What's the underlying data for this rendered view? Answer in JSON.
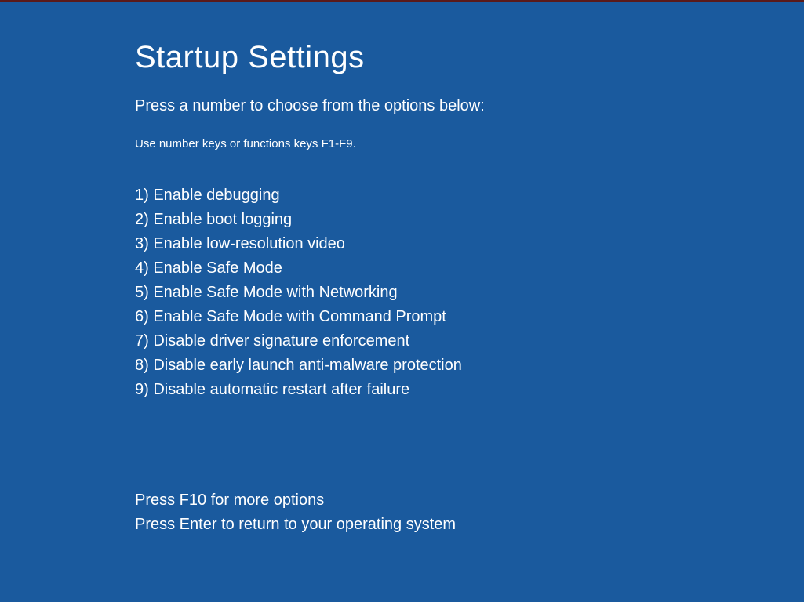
{
  "title": "Startup Settings",
  "instruction": "Press a number to choose from the options below:",
  "hint": "Use number keys or functions keys F1-F9.",
  "options": [
    "1) Enable debugging",
    "2) Enable boot logging",
    "3) Enable low-resolution video",
    "4) Enable Safe Mode",
    "5) Enable Safe Mode with Networking",
    "6) Enable Safe Mode with Command Prompt",
    "7) Disable driver signature enforcement",
    "8) Disable early launch anti-malware protection",
    "9) Disable automatic restart after failure"
  ],
  "footer": {
    "more": "Press F10 for more options",
    "return": "Press Enter to return to your operating system"
  }
}
